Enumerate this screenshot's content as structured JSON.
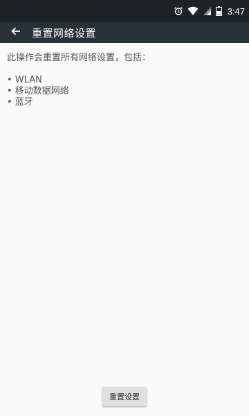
{
  "status_bar": {
    "time": "3:47",
    "icons": [
      "alarm-icon",
      "wifi-icon",
      "signal-icon",
      "battery-icon"
    ]
  },
  "app_bar": {
    "back_icon": "arrow-back-icon",
    "title": "重置网络设置"
  },
  "content": {
    "description": "此操作会重置所有网络设置，包括：",
    "items": [
      "• WLAN",
      "• 移动数据网络",
      "• 蓝牙"
    ]
  },
  "actions": {
    "reset_label": "重置设置"
  },
  "colors": {
    "status_bar": "#1c2428",
    "app_bar": "#263238",
    "background": "#fafafa",
    "text": "#555555",
    "button": "#e0e0e0"
  }
}
